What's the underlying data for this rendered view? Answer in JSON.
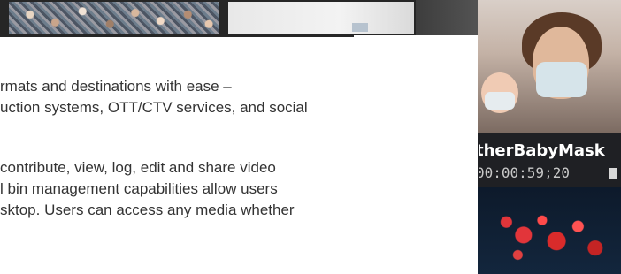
{
  "video_panel": {
    "clip_title": "therBabyMask",
    "timecode": "00:00:59;20"
  },
  "article": {
    "paragraph1": [
      "rmats and destinations with ease –",
      "uction systems, OTT/CTV services, and social"
    ],
    "paragraph2": [
      "contribute, view, log, edit and share video",
      "l bin management capabilities allow users",
      "sktop. Users can access any media whether"
    ]
  }
}
